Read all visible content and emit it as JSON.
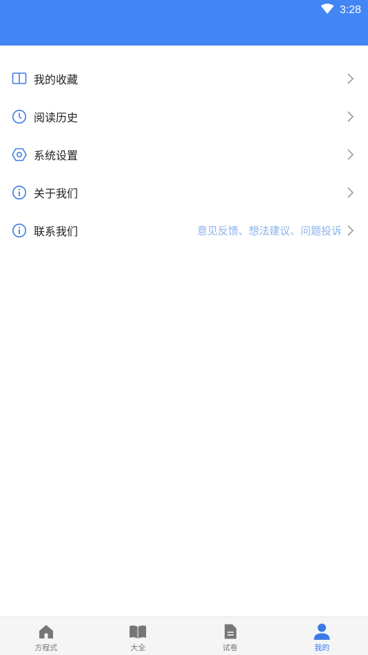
{
  "status_bar": {
    "time": "3:28",
    "background": "#4285f4"
  },
  "menu": {
    "items": [
      {
        "label": "我的收藏",
        "icon": "book-open-icon",
        "extra": ""
      },
      {
        "label": "阅读历史",
        "icon": "clock-icon",
        "extra": ""
      },
      {
        "label": "系统设置",
        "icon": "settings-hexagon-icon",
        "extra": ""
      },
      {
        "label": "关于我们",
        "icon": "info-icon",
        "extra": ""
      },
      {
        "label": "联系我们",
        "icon": "info-icon",
        "extra": "意见反馈、想法建议、问题投诉"
      }
    ],
    "accent_color": "#3d7ae6",
    "extra_color": "#8bb0ea"
  },
  "tab_bar": {
    "tabs": [
      {
        "label": "方程式",
        "icon": "home-icon",
        "active": false
      },
      {
        "label": "大全",
        "icon": "book-icon",
        "active": false
      },
      {
        "label": "试卷",
        "icon": "document-icon",
        "active": false
      },
      {
        "label": "我的",
        "icon": "user-icon",
        "active": true
      }
    ]
  }
}
